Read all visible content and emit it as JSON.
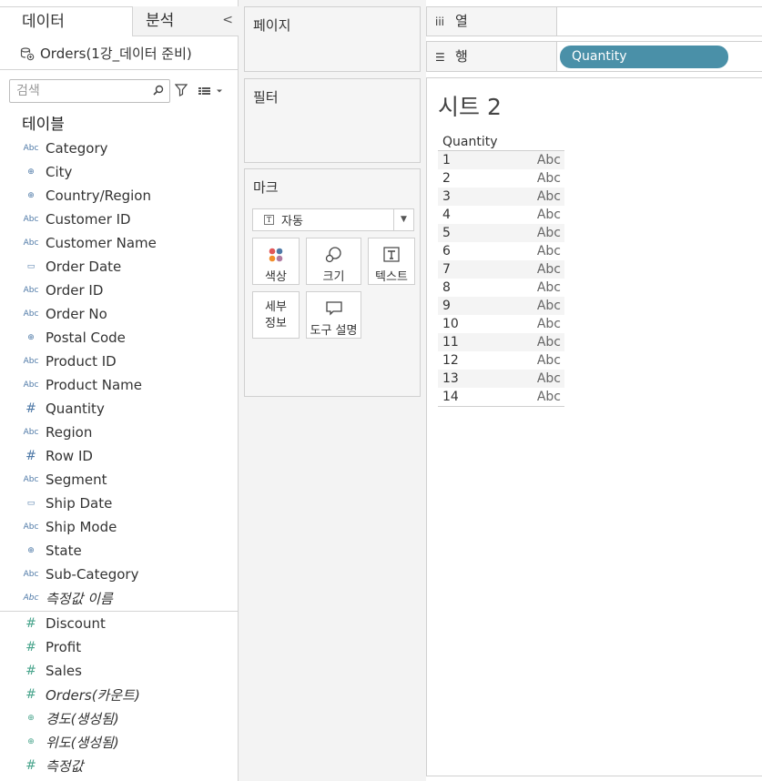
{
  "left": {
    "tabs": {
      "data": "데이터",
      "analysis": "분석",
      "collapse": "<"
    },
    "datasource": "Orders(1강_데이터 준비)",
    "search": {
      "placeholder": "검색"
    },
    "tables_title": "테이블",
    "dimensions": [
      {
        "name": "Category",
        "type": "abc",
        "italic": false
      },
      {
        "name": "City",
        "type": "geo",
        "italic": false
      },
      {
        "name": "Country/Region",
        "type": "geo",
        "italic": false
      },
      {
        "name": "Customer ID",
        "type": "abc",
        "italic": false
      },
      {
        "name": "Customer Name",
        "type": "abc",
        "italic": false
      },
      {
        "name": "Order Date",
        "type": "date",
        "italic": false
      },
      {
        "name": "Order ID",
        "type": "abc",
        "italic": false
      },
      {
        "name": "Order No",
        "type": "abc",
        "italic": false
      },
      {
        "name": "Postal Code",
        "type": "geo",
        "italic": false
      },
      {
        "name": "Product ID",
        "type": "abc",
        "italic": false
      },
      {
        "name": "Product Name",
        "type": "abc",
        "italic": false
      },
      {
        "name": "Quantity",
        "type": "hash",
        "italic": false
      },
      {
        "name": "Region",
        "type": "abc",
        "italic": false
      },
      {
        "name": "Row ID",
        "type": "hash",
        "italic": false
      },
      {
        "name": "Segment",
        "type": "abc",
        "italic": false
      },
      {
        "name": "Ship Date",
        "type": "date",
        "italic": false
      },
      {
        "name": "Ship Mode",
        "type": "abc",
        "italic": false
      },
      {
        "name": "State",
        "type": "geo",
        "italic": false
      },
      {
        "name": "Sub-Category",
        "type": "abc",
        "italic": false
      },
      {
        "name": "측정값 이름",
        "type": "abc",
        "italic": true
      }
    ],
    "measures": [
      {
        "name": "Discount",
        "type": "hash",
        "italic": false
      },
      {
        "name": "Profit",
        "type": "hash",
        "italic": false
      },
      {
        "name": "Sales",
        "type": "hash",
        "italic": false
      },
      {
        "name": "Orders(카운트)",
        "type": "hash",
        "italic": true
      },
      {
        "name": "경도(생성됨)",
        "type": "geo",
        "italic": true
      },
      {
        "name": "위도(생성됨)",
        "type": "geo",
        "italic": true
      },
      {
        "name": "측정값",
        "type": "hash",
        "italic": true
      }
    ],
    "icon_text": {
      "abc": "Abc",
      "geo": "⊕",
      "date": "▭",
      "hash": "#"
    }
  },
  "mid": {
    "pages_title": "페이지",
    "filters_title": "필터",
    "marks_title": "마크",
    "mark_type": "자동",
    "mark_buttons": {
      "color": "색상",
      "size": "크기",
      "text": "텍스트",
      "detail_1": "세부",
      "detail_2": "정보",
      "tooltip": "도구 설명"
    }
  },
  "shelves": {
    "columns_label": "열",
    "rows_label": "행",
    "rows_pill": "Quantity"
  },
  "sheet": {
    "title": "시트 2",
    "header": "Quantity",
    "rows": [
      {
        "k": "1",
        "v": "Abc"
      },
      {
        "k": "2",
        "v": "Abc"
      },
      {
        "k": "3",
        "v": "Abc"
      },
      {
        "k": "4",
        "v": "Abc"
      },
      {
        "k": "5",
        "v": "Abc"
      },
      {
        "k": "6",
        "v": "Abc"
      },
      {
        "k": "7",
        "v": "Abc"
      },
      {
        "k": "8",
        "v": "Abc"
      },
      {
        "k": "9",
        "v": "Abc"
      },
      {
        "k": "10",
        "v": "Abc"
      },
      {
        "k": "11",
        "v": "Abc"
      },
      {
        "k": "12",
        "v": "Abc"
      },
      {
        "k": "13",
        "v": "Abc"
      },
      {
        "k": "14",
        "v": "Abc"
      }
    ]
  },
  "colors": {
    "pill": "#4a90a8",
    "dim_icon": "#4e79a7",
    "measure_icon": "#4aa58d"
  }
}
